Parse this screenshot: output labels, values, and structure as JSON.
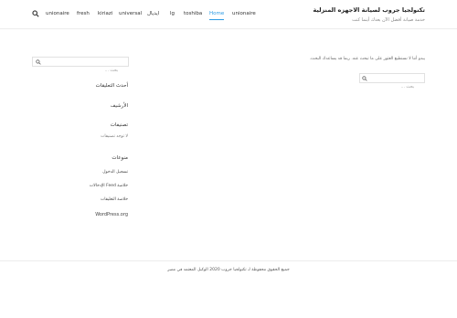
{
  "site": {
    "title": "تكنولجيا جروب لصيانة الاجهزه المنزلية",
    "description": "خدمة صيانة أفضل الآن بعدك أينما كنت"
  },
  "nav": {
    "search_icon": "search-icon",
    "items": [
      {
        "label": "unionaire"
      },
      {
        "label": "fresh"
      },
      {
        "label": "kiriazi"
      },
      {
        "label": "universal"
      },
      {
        "label": "ايديال"
      },
      {
        "label": "lg"
      },
      {
        "label": "toshiba"
      },
      {
        "label": "Home",
        "active": true
      },
      {
        "label": "unionaire"
      }
    ],
    "active_color": "#2c9be5"
  },
  "content": {
    "message": "يبدو أننا لا نستطيع العثور على ما تبحث عنه. ربما قد يساعدك البحث.",
    "search_placeholder": "بحث …",
    "search_icon": "search-icon"
  },
  "sidebar": {
    "search_placeholder": "بحث …",
    "search_icon": "search-icon",
    "recent_comments_title": "أحدث التعليقات",
    "archives_title": "الأرشيف",
    "categories_title": "تصنيفات",
    "no_categories": "لا توجد تصنيفات",
    "meta_title": "منوعات",
    "meta_links": [
      "تسجيل الدخول",
      "خلاصة Feed الإدخالات",
      "خلاصة التعليقات",
      "WordPress.org"
    ]
  },
  "footer": {
    "text": "جميع الحقوق محفوظة لـ تكنولجيا جروب 2020 الوكيل المعتمد في مصر"
  }
}
